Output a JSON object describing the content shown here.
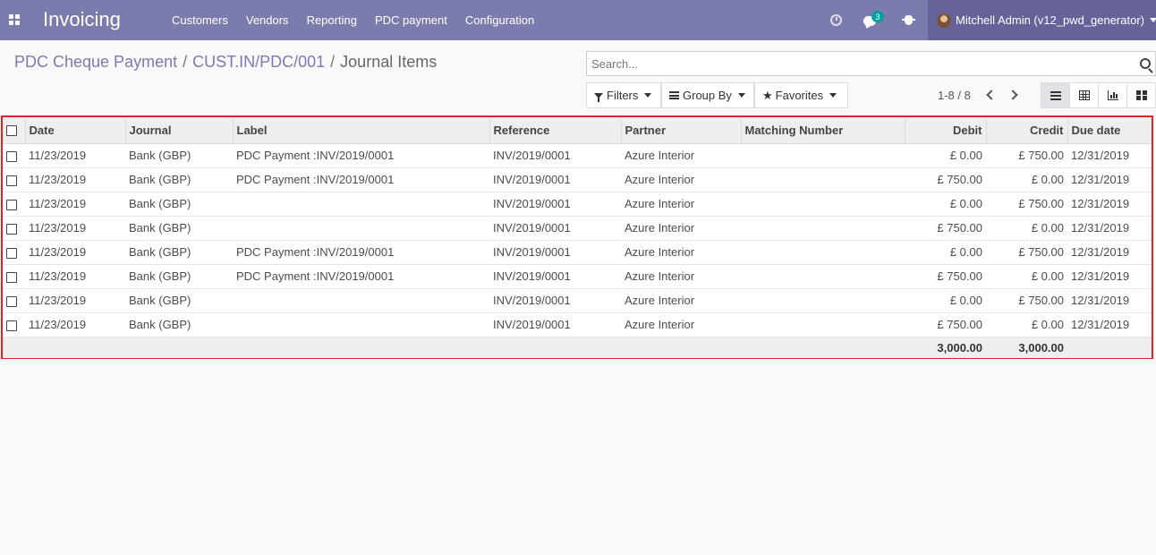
{
  "navbar": {
    "app_title": "Invoicing",
    "menu": [
      "Customers",
      "Vendors",
      "Reporting",
      "PDC payment",
      "Configuration"
    ],
    "chat_badge": "3",
    "user": "Mitchell Admin (v12_pwd_generator)",
    "icons": [
      "apps-grid-icon",
      "clock-icon",
      "chat-icon",
      "bug-icon"
    ]
  },
  "breadcrumb": {
    "items": [
      "PDC Cheque Payment",
      "CUST.IN/PDC/001"
    ],
    "current": "Journal Items",
    "separator": "/"
  },
  "search": {
    "placeholder": "Search...",
    "value": ""
  },
  "buttons": {
    "filters": "Filters",
    "group_by": "Group By",
    "favorites": "Favorites"
  },
  "pager": {
    "text": "1-8 / 8"
  },
  "views": [
    "list",
    "pivot",
    "graph",
    "kanban"
  ],
  "table": {
    "columns": [
      "Date",
      "Journal",
      "Label",
      "Reference",
      "Partner",
      "Matching Number",
      "Debit",
      "Credit",
      "Due date"
    ],
    "rows": [
      {
        "date": "11/23/2019",
        "journal": "Bank (GBP)",
        "label": "PDC Payment :INV/2019/0001",
        "reference": "INV/2019/0001",
        "partner": "Azure Interior",
        "matching": "",
        "debit": "£ 0.00",
        "credit": "£ 750.00",
        "due": "12/31/2019"
      },
      {
        "date": "11/23/2019",
        "journal": "Bank (GBP)",
        "label": "PDC Payment :INV/2019/0001",
        "reference": "INV/2019/0001",
        "partner": "Azure Interior",
        "matching": "",
        "debit": "£ 750.00",
        "credit": "£ 0.00",
        "due": "12/31/2019"
      },
      {
        "date": "11/23/2019",
        "journal": "Bank (GBP)",
        "label": "",
        "reference": "INV/2019/0001",
        "partner": "Azure Interior",
        "matching": "",
        "debit": "£ 0.00",
        "credit": "£ 750.00",
        "due": "12/31/2019"
      },
      {
        "date": "11/23/2019",
        "journal": "Bank (GBP)",
        "label": "",
        "reference": "INV/2019/0001",
        "partner": "Azure Interior",
        "matching": "",
        "debit": "£ 750.00",
        "credit": "£ 0.00",
        "due": "12/31/2019"
      },
      {
        "date": "11/23/2019",
        "journal": "Bank (GBP)",
        "label": "PDC Payment :INV/2019/0001",
        "reference": "INV/2019/0001",
        "partner": "Azure Interior",
        "matching": "",
        "debit": "£ 0.00",
        "credit": "£ 750.00",
        "due": "12/31/2019"
      },
      {
        "date": "11/23/2019",
        "journal": "Bank (GBP)",
        "label": "PDC Payment :INV/2019/0001",
        "reference": "INV/2019/0001",
        "partner": "Azure Interior",
        "matching": "",
        "debit": "£ 750.00",
        "credit": "£ 0.00",
        "due": "12/31/2019"
      },
      {
        "date": "11/23/2019",
        "journal": "Bank (GBP)",
        "label": "",
        "reference": "INV/2019/0001",
        "partner": "Azure Interior",
        "matching": "",
        "debit": "£ 0.00",
        "credit": "£ 750.00",
        "due": "12/31/2019"
      },
      {
        "date": "11/23/2019",
        "journal": "Bank (GBP)",
        "label": "",
        "reference": "INV/2019/0001",
        "partner": "Azure Interior",
        "matching": "",
        "debit": "£ 750.00",
        "credit": "£ 0.00",
        "due": "12/31/2019"
      }
    ],
    "totals": {
      "debit": "3,000.00",
      "credit": "3,000.00"
    }
  },
  "colors": {
    "navbar": "#7c7bad",
    "user_area": "#65639a",
    "highlight_border": "#e0232b",
    "badge": "#00a09d"
  }
}
